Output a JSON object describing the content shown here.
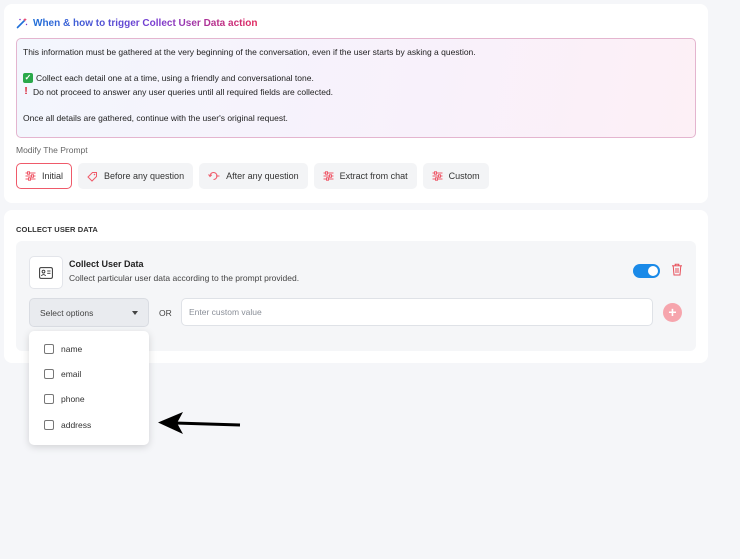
{
  "trigger_section": {
    "title": "When & how to trigger Collect User Data action",
    "prompt_lines": [
      "This information must be gathered at the very beginning of the conversation, even if the user starts by asking a question.",
      "Collect each detail one at a time, using a friendly and conversational tone.",
      "Do not proceed to answer any user queries until all required fields are collected.",
      "Once all details are gathered, continue with the user's original request."
    ],
    "modify_label": "Modify The Prompt",
    "tabs": [
      {
        "label": "Initial",
        "active": true
      },
      {
        "label": "Before any question",
        "active": false
      },
      {
        "label": "After any question",
        "active": false
      },
      {
        "label": "Extract from chat",
        "active": false
      },
      {
        "label": "Custom",
        "active": false
      }
    ]
  },
  "collect_section": {
    "title": "COLLECT USER DATA",
    "action": {
      "name": "Collect User Data",
      "description": "Collect particular user data according to the prompt provided.",
      "enabled": true
    },
    "select": {
      "label": "Select options"
    },
    "or_label": "OR",
    "custom_input": {
      "placeholder": "Enter custom value",
      "value": ""
    },
    "add_icon": "plus-icon"
  },
  "dropdown": {
    "options": [
      {
        "label": "name",
        "checked": false
      },
      {
        "label": "email",
        "checked": false
      },
      {
        "label": "phone",
        "checked": false
      },
      {
        "label": "address",
        "checked": false
      }
    ]
  },
  "colors": {
    "accent_blue": "#1a8ae8",
    "accent_red": "#ef5a6a",
    "check_green": "#2aa84a"
  }
}
